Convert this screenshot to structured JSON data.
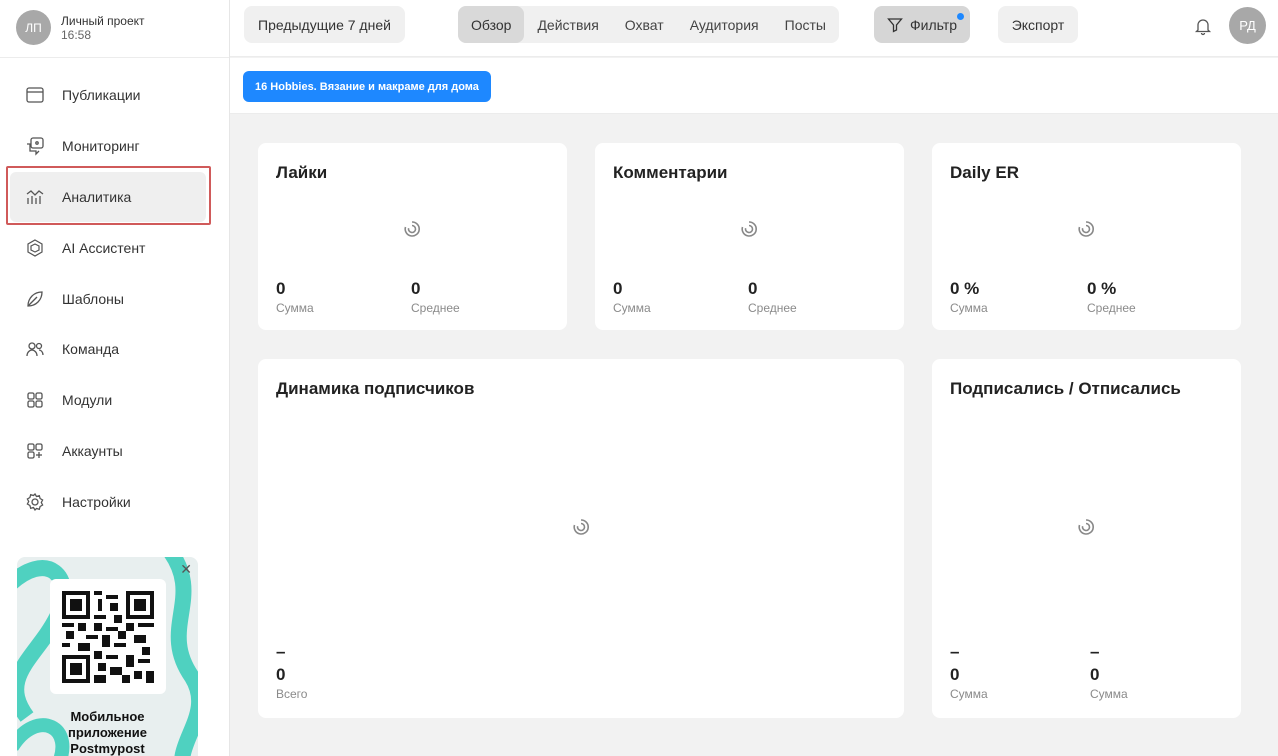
{
  "project": {
    "initials": "ЛП",
    "name": "Личный проект",
    "time": "16:58"
  },
  "nav": [
    {
      "label": "Публикации",
      "icon": "calendar-icon"
    },
    {
      "label": "Мониторинг",
      "icon": "chat-monitor-icon"
    },
    {
      "label": "Аналитика",
      "icon": "analytics-icon",
      "active": true
    },
    {
      "label": "AI Ассистент",
      "icon": "ai-icon"
    },
    {
      "label": "Шаблоны",
      "icon": "template-icon"
    },
    {
      "label": "Команда",
      "icon": "team-icon"
    },
    {
      "label": "Модули",
      "icon": "modules-icon"
    },
    {
      "label": "Аккаунты",
      "icon": "accounts-icon"
    },
    {
      "label": "Настройки",
      "icon": "settings-icon"
    }
  ],
  "promo": {
    "title_l1": "Мобильное",
    "title_l2": "приложение",
    "title_l3": "Postmypost",
    "close": "✕"
  },
  "topbar": {
    "period": "Предыдущие 7 дней",
    "tabs": [
      "Обзор",
      "Действия",
      "Охват",
      "Аудитория",
      "Посты"
    ],
    "active_tab": "Обзор",
    "filter": "Фильтр",
    "export": "Экспорт",
    "user_initials": "РД"
  },
  "account_chip": "16 Hobbies. Вязание и макраме для дома",
  "cards": {
    "likes": {
      "title": "Лайки",
      "sum_value": "0",
      "sum_label": "Сумма",
      "avg_value": "0",
      "avg_label": "Среднее"
    },
    "comments": {
      "title": "Комментарии",
      "sum_value": "0",
      "sum_label": "Сумма",
      "avg_value": "0",
      "avg_label": "Среднее"
    },
    "daily_er": {
      "title": "Daily ER",
      "sum_value": "0 %",
      "sum_label": "Сумма",
      "avg_value": "0 %",
      "avg_label": "Среднее"
    },
    "followers": {
      "title": "Динамика подписчиков",
      "dash": "–",
      "total_value": "0",
      "total_label": "Всего"
    },
    "subs": {
      "title": "Подписались / Отписались",
      "dash1": "–",
      "v1": "0",
      "l1": "Сумма",
      "dash2": "–",
      "v2": "0",
      "l2": "Сумма"
    }
  },
  "colors": {
    "accent": "#1e88ff",
    "active_frame": "#d05a5a",
    "promo_teal": "#4fd1c0"
  }
}
